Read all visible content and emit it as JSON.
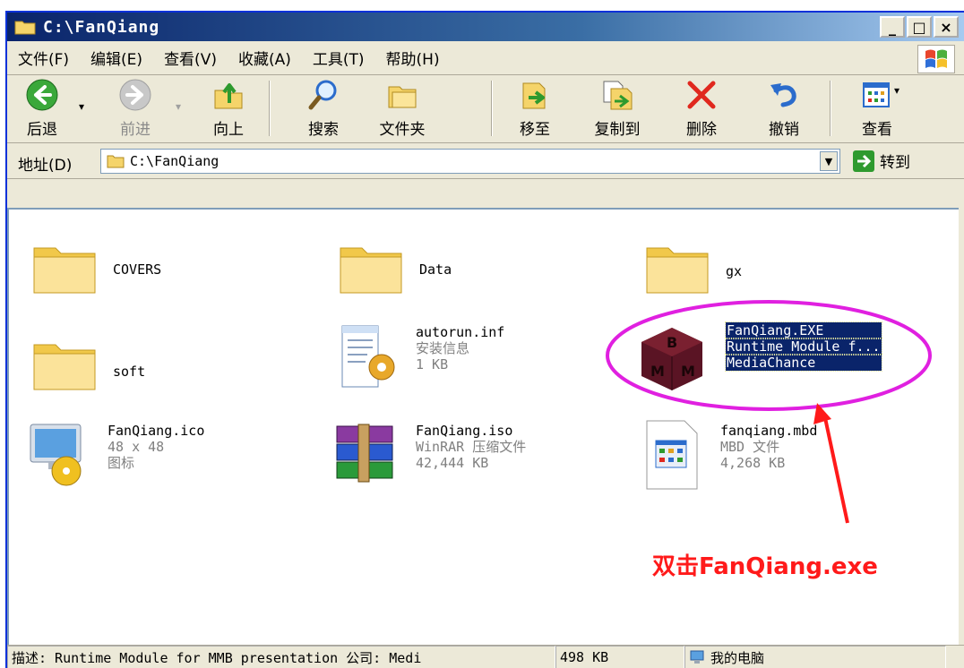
{
  "window": {
    "title": "C:\\FanQiang",
    "buttons": {
      "minimize": "_",
      "maximize": "□",
      "close": "×"
    }
  },
  "menu": [
    "文件(F)",
    "编辑(E)",
    "查看(V)",
    "收藏(A)",
    "工具(T)",
    "帮助(H)"
  ],
  "toolbar": {
    "back": "后退",
    "forward": "前进",
    "up": "向上",
    "search": "搜索",
    "folders": "文件夹",
    "move_to": "移至",
    "copy_to": "复制到",
    "delete": "删除",
    "undo": "撤销",
    "views": "查看"
  },
  "address": {
    "label": "地址(D)",
    "value": "C:\\FanQiang",
    "go": "转到"
  },
  "files": [
    {
      "name": "COVERS",
      "type": "folder"
    },
    {
      "name": "Data",
      "type": "folder"
    },
    {
      "name": "gx",
      "type": "folder"
    },
    {
      "name": "soft",
      "type": "folder"
    },
    {
      "name": "autorun.inf",
      "line2": "安装信息",
      "line3": "1 KB",
      "type": "inf"
    },
    {
      "name": "FanQiang.EXE",
      "line2": "Runtime Module f...",
      "line3": "MediaChance",
      "type": "exe",
      "selected": true
    },
    {
      "name": "FanQiang.ico",
      "line2": "48 x 48",
      "line3": "图标",
      "type": "ico"
    },
    {
      "name": "FanQiang.iso",
      "line2": "WinRAR 压缩文件",
      "line3": "42,444 KB",
      "type": "iso"
    },
    {
      "name": "fanqiang.mbd",
      "line2": "MBD 文件",
      "line3": "4,268 KB",
      "type": "mbd"
    }
  ],
  "statusbar": {
    "description": "描述: Runtime Module for MMB presentation 公司: Medi",
    "size": "498 KB",
    "zone": "我的电脑"
  },
  "annotation": {
    "text": "双击FanQiang.exe"
  },
  "colors": {
    "annotation": "#ff1a1a",
    "ellipse": "#e020e0",
    "selection": "#0a246a",
    "titlebar": "#0a246a"
  }
}
